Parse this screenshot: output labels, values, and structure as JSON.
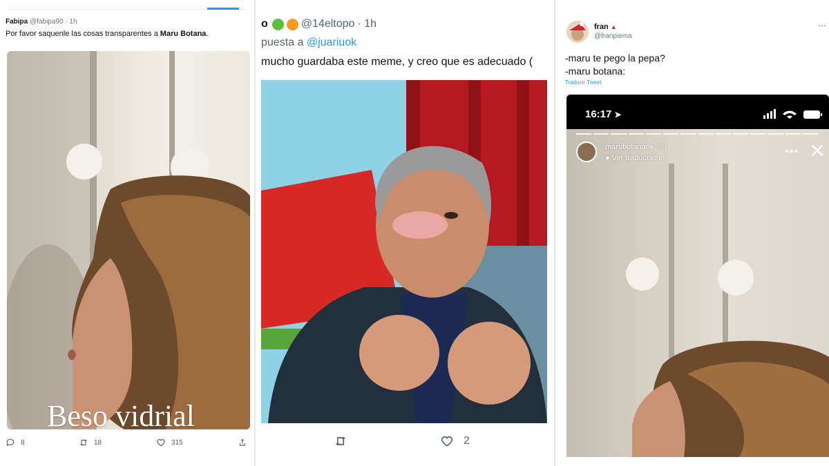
{
  "tweet1": {
    "name": "Fabipa",
    "handle": "@fabipa90",
    "time": "· 1h",
    "text_prefix": "Por favor saquenle las cosas transparentes a ",
    "text_bold": "Maru Botana",
    "text_suffix": ".",
    "media_caption": "Beso vidrial",
    "replies": "8",
    "retweets": "18",
    "likes": "315",
    "icons": [
      "reply-icon",
      "retweet-icon",
      "like-icon",
      "share-icon"
    ]
  },
  "tweet2": {
    "name": "o",
    "handle": "@14eltopo",
    "time": "· 1h",
    "reply_prefix": "puesta a ",
    "reply_handle": "@juariuok",
    "text": "mucho guardaba este meme, y creo que es adecuado (",
    "likes": "2",
    "emoji_colors": [
      "#5bbf3a",
      "#f59c1a"
    ],
    "icons": [
      "retweet-icon",
      "like-icon"
    ]
  },
  "tweet3": {
    "name": "fran",
    "handle": "@franpiema",
    "line1": "-maru te pego la pepa?",
    "line2": "-maru botana:",
    "translate": "Traducir Tweet",
    "more": "⋯",
    "phone_time": "16:17",
    "story_user": "marubotanaok",
    "story_time": "9h",
    "story_translate": "Ver traducción"
  },
  "colors": {
    "link": "#1d9bf0",
    "muted": "#536471"
  }
}
